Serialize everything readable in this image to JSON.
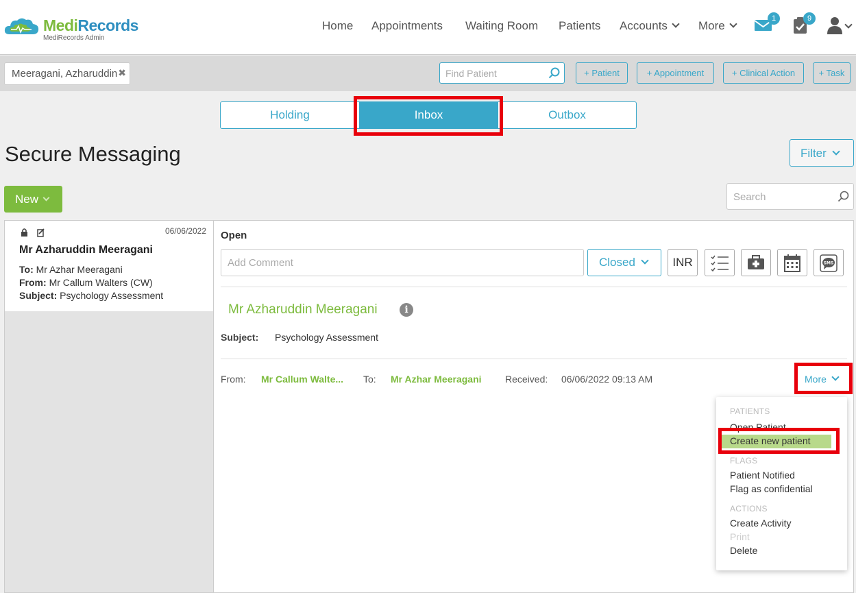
{
  "brand": {
    "name_part1": "Medi",
    "name_part2": "Records",
    "subtitle": "MediRecords Admin"
  },
  "nav": {
    "items": [
      {
        "label": "Home"
      },
      {
        "label": "Appointments"
      },
      {
        "label": "Waiting Room"
      },
      {
        "label": "Patients"
      },
      {
        "label": "Accounts"
      },
      {
        "label": "More"
      }
    ],
    "messages_badge": "1",
    "tasks_badge": "9"
  },
  "patient_bar": {
    "current_patient": "Meeragani, Azharuddin",
    "find_placeholder": "Find Patient",
    "buttons": [
      "+ Patient",
      "+ Appointment",
      "+ Clinical Action",
      "+ Task"
    ]
  },
  "tabs": {
    "holding": "Holding",
    "inbox": "Inbox",
    "outbox": "Outbox",
    "active": "inbox"
  },
  "page_title": "Secure Messaging",
  "filter_label": "Filter",
  "new_label": "New",
  "search_placeholder": "Search",
  "message_list": [
    {
      "date": "06/06/2022",
      "name": "Mr Azharuddin Meeragani",
      "to_label": "To:",
      "to": "Mr Azhar Meeragani",
      "from_label": "From:",
      "from": "Mr Callum Walters (CW)",
      "subject_label": "Subject:",
      "subject": "Psychology Assessment"
    }
  ],
  "detail": {
    "status_label": "Open",
    "comment_placeholder": "Add Comment",
    "closed_label": "Closed",
    "inr_label": "INR",
    "sender_name": "Mr Azharuddin Meeragani",
    "subject_label": "Subject:",
    "subject": "Psychology Assessment",
    "from_label": "From:",
    "from": "Mr Callum Walte...",
    "to_label": "To:",
    "to": "Mr Azhar Meeragani",
    "received_label": "Received:",
    "received": "06/06/2022 09:13 AM",
    "more_label": "More"
  },
  "more_menu": {
    "patients_header": "PATIENTS",
    "open_patient": "Open Patient",
    "create_new_patient": "Create new patient",
    "flags_header": "FLAGS",
    "patient_notified": "Patient Notified",
    "flag_confidential": "Flag as confidential",
    "actions_header": "ACTIONS",
    "create_activity": "Create Activity",
    "print": "Print",
    "delete": "Delete"
  },
  "colors": {
    "accent": "#39a7c9",
    "green": "#7dbb3e",
    "highlight_box": "#e8000b"
  }
}
